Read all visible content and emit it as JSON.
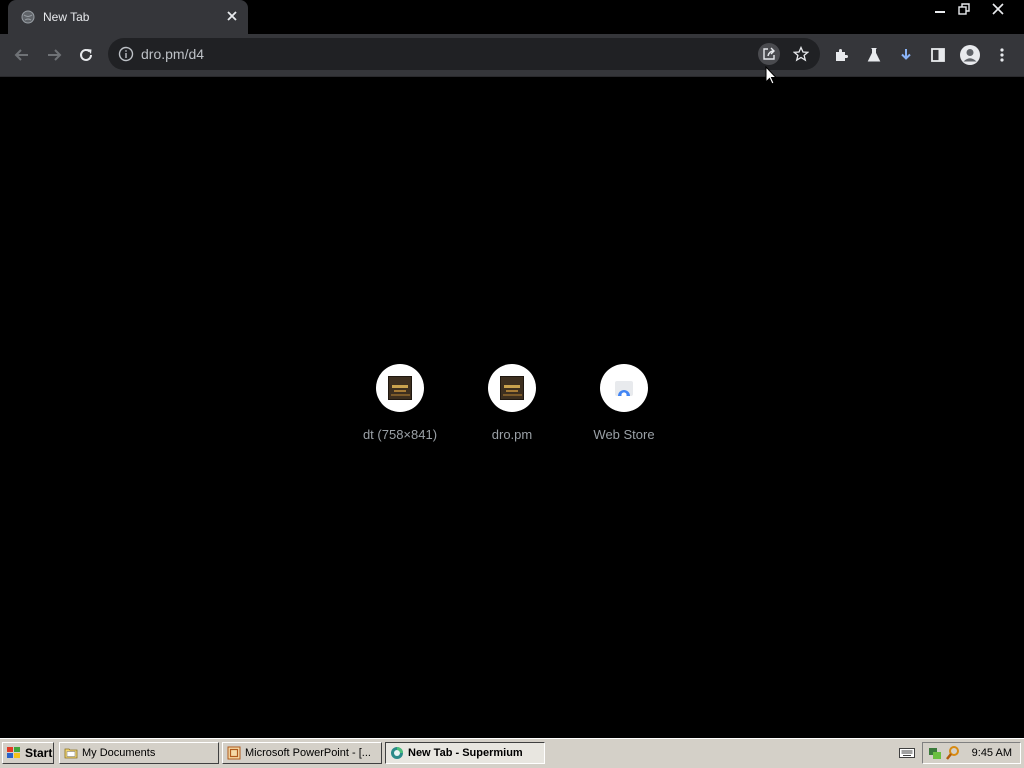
{
  "browser": {
    "tab": {
      "title": "New Tab"
    },
    "address_bar": {
      "url": "dro.pm/d4"
    }
  },
  "shortcuts": [
    {
      "label": "dt (758×841)"
    },
    {
      "label": "dro.pm"
    },
    {
      "label": "Web Store"
    }
  ],
  "taskbar": {
    "start_label": "Start",
    "tasks": [
      {
        "label": "My Documents"
      },
      {
        "label": "Microsoft PowerPoint - [..."
      },
      {
        "label": "New Tab - Supermium"
      }
    ],
    "clock": "9:45 AM"
  },
  "colors": {
    "page_background": "#000000",
    "toolbar": "#35363a",
    "omnibox": "#202124",
    "download_accent": "#8ab4f8",
    "taskbar": "#d4d0c8"
  }
}
